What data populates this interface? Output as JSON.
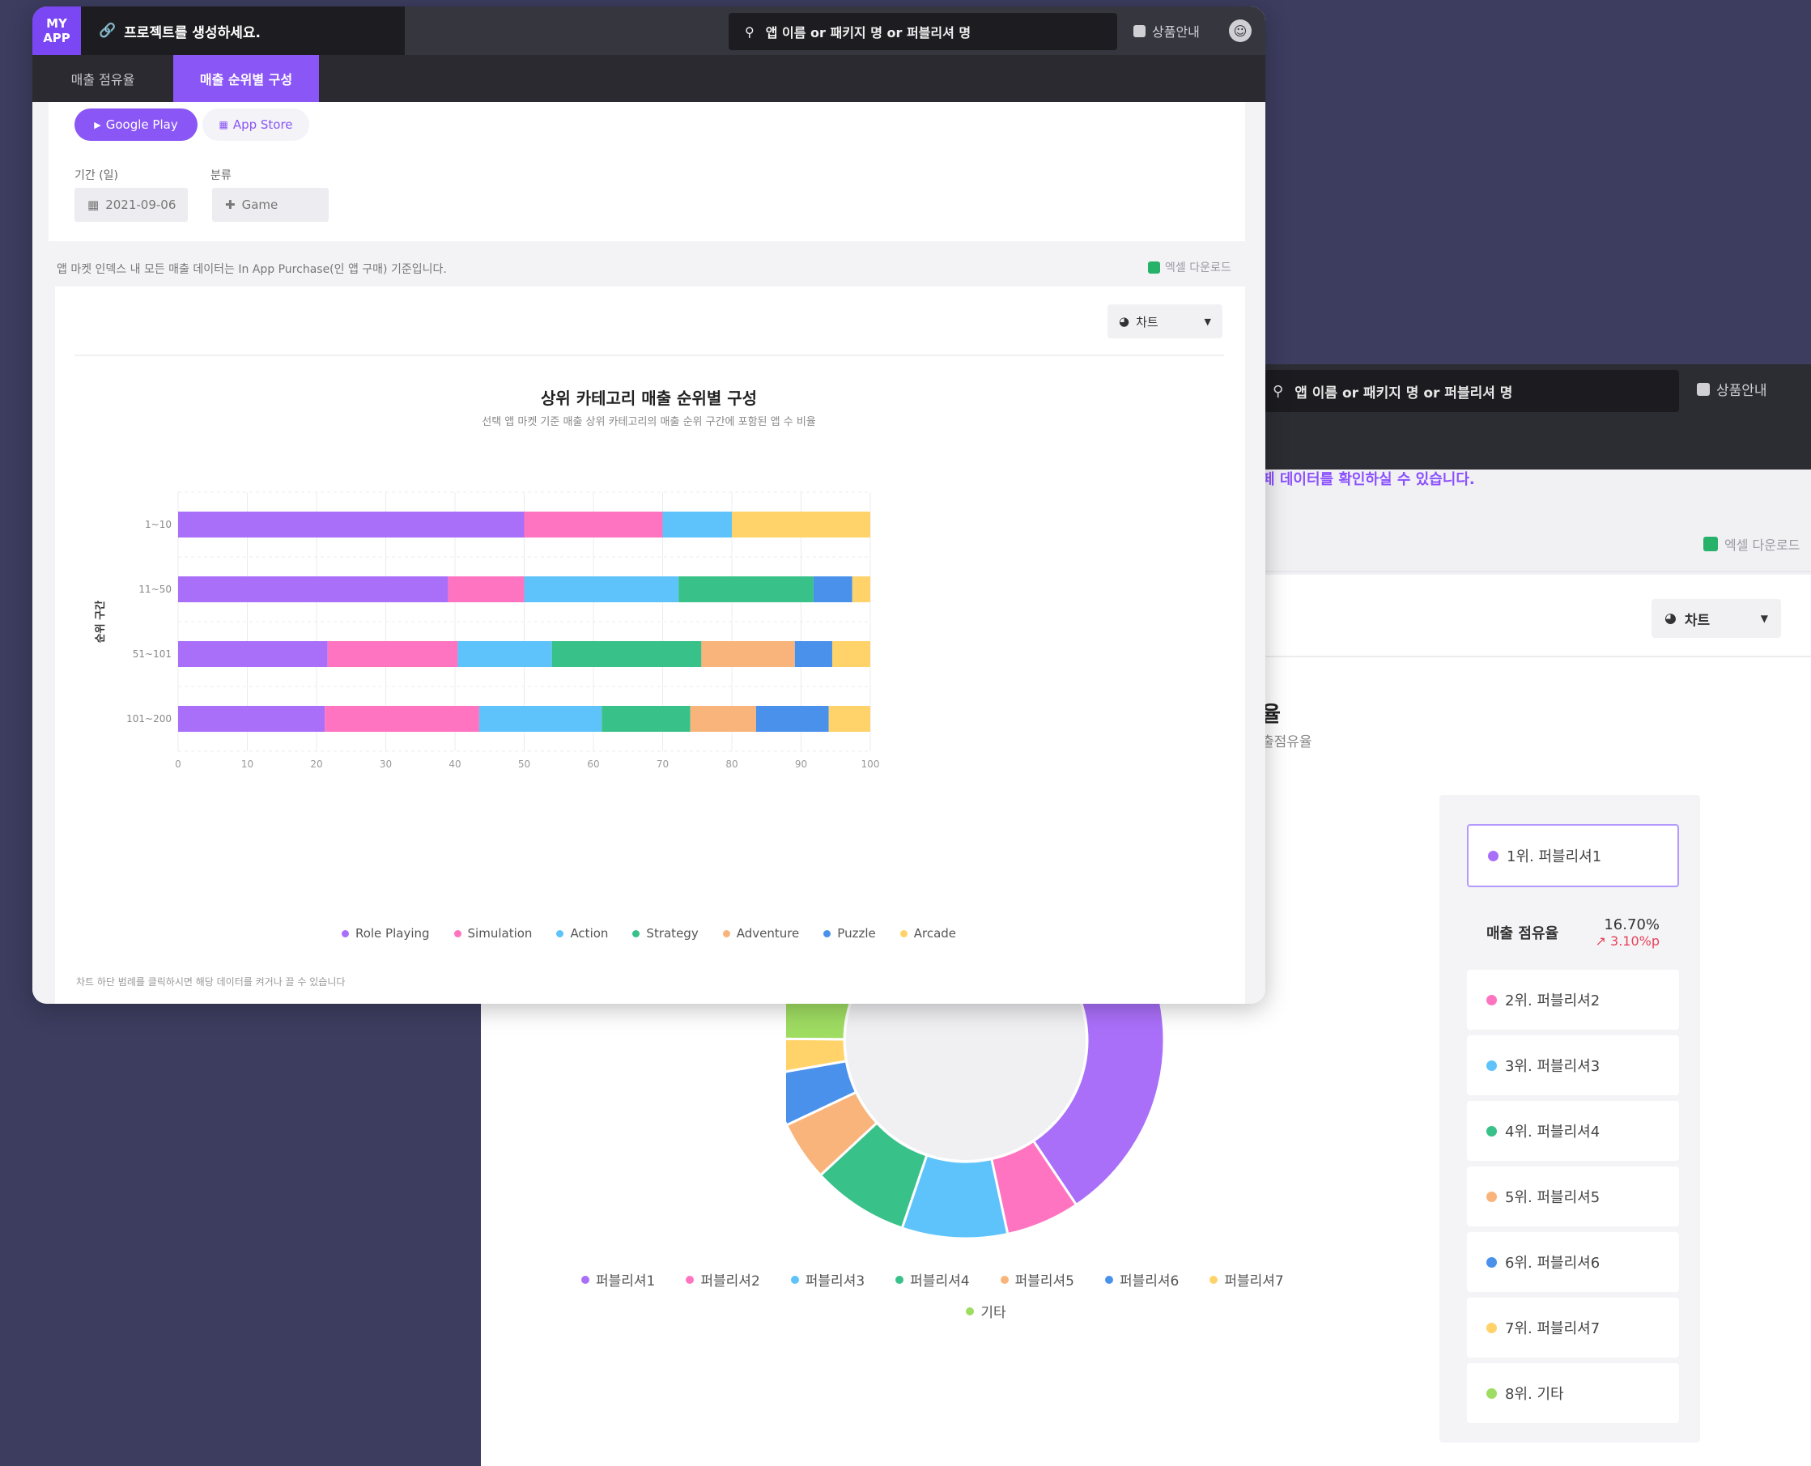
{
  "colors": {
    "accent": "#8a57f6",
    "role_playing": "#a96ff9",
    "simulation": "#ff74c0",
    "action": "#5ec3fb",
    "strategy": "#39c18a",
    "adventure": "#f9b47b",
    "puzzle": "#4a91ec",
    "arcade": "#ffd36a",
    "etc": "#9fdc62"
  },
  "front": {
    "brand": "MY\nAPP",
    "project": "프로젝트를 생성하세요.",
    "search_placeholder": "앱 이름 or 패키지 명 or 퍼블리셔 명",
    "product_info": "상품안내",
    "tabs": [
      {
        "label": "매출 점유율"
      },
      {
        "label": "매출 순위별 구성"
      }
    ],
    "store_pills": [
      {
        "label": "Google Play"
      },
      {
        "label": "App Store"
      }
    ],
    "period_label": "기간 (일)",
    "period_value": "2021-09-06",
    "category_label": "분류",
    "category_value": "Game",
    "notice": "앱 마켓 인덱스 내 모든 매출 데이터는 In App Purchase(인 앱 구매) 기준입니다.",
    "excel": "엑셀 다운로드",
    "chart_toggle": "차트",
    "footnote": "차트 하단 범례를 클릭하시면 해당 데이터를 켜거나 끌 수 있습니다"
  },
  "back": {
    "search_placeholder": "앱 이름 or 패키지 명 or 퍼블리셔 명",
    "product_info": "상품안내",
    "notice": "페 데이터를 확인하실 수 있습니다.",
    "excel": "엑셀 다운로드",
    "chart_toggle": "차트",
    "partial_title": "율",
    "partial_sub": "출점유율",
    "share_label": "매출 점유율",
    "share_value": "16.70%",
    "share_delta": "3.10%p",
    "ranks": [
      {
        "label": "1위. 퍼블리셔1",
        "color": "#a96ff9"
      },
      {
        "label": "2위. 퍼블리셔2",
        "color": "#ff74c0"
      },
      {
        "label": "3위. 퍼블리셔3",
        "color": "#5ec3fb"
      },
      {
        "label": "4위. 퍼블리셔4",
        "color": "#39c18a"
      },
      {
        "label": "5위. 퍼블리셔5",
        "color": "#f9b47b"
      },
      {
        "label": "6위. 퍼블리셔6",
        "color": "#4a91ec"
      },
      {
        "label": "7위. 퍼블리셔7",
        "color": "#ffd36a"
      },
      {
        "label": "8위. 기타",
        "color": "#9fdc62"
      }
    ],
    "legend": [
      {
        "name": "퍼블리셔1",
        "color": "#a96ff9"
      },
      {
        "name": "퍼블리셔2",
        "color": "#ff74c0"
      },
      {
        "name": "퍼블리셔3",
        "color": "#5ec3fb"
      },
      {
        "name": "퍼블리셔4",
        "color": "#39c18a"
      },
      {
        "name": "퍼블리셔5",
        "color": "#f9b47b"
      },
      {
        "name": "퍼블리셔6",
        "color": "#4a91ec"
      },
      {
        "name": "퍼블리셔7",
        "color": "#ffd36a"
      },
      {
        "name": "기타",
        "color": "#9fdc62"
      }
    ]
  },
  "chart_data": [
    {
      "type": "bar",
      "orientation": "horizontal",
      "stacked": true,
      "title": "상위 카테고리 매출 순위별 구성",
      "subtitle": "선택 앱 마켓 기준 매출 상위 카테고리의 매출 순위 구간에 포함된 앱 수 비율",
      "ylabel": "순위 구간",
      "xlabel": "",
      "categories": [
        "1~10",
        "11~50",
        "51~101",
        "101~200"
      ],
      "xlim": [
        0,
        100
      ],
      "xticks": [
        0,
        10,
        20,
        30,
        40,
        50,
        60,
        70,
        80,
        90,
        100
      ],
      "grid": true,
      "legend_position": "bottom",
      "series": [
        {
          "name": "Role Playing",
          "color": "#a96ff9",
          "values": [
            50,
            39,
            21.6,
            21.2
          ]
        },
        {
          "name": "Simulation",
          "color": "#ff74c0",
          "values": [
            20,
            11,
            18.8,
            22.3
          ]
        },
        {
          "name": "Action",
          "color": "#5ec3fb",
          "values": [
            10,
            22.3,
            13.6,
            17.7
          ]
        },
        {
          "name": "Strategy",
          "color": "#39c18a",
          "values": [
            0,
            19.5,
            21.6,
            12.8
          ]
        },
        {
          "name": "Adventure",
          "color": "#f9b47b",
          "values": [
            0,
            0,
            13.5,
            9.5
          ]
        },
        {
          "name": "Puzzle",
          "color": "#4a91ec",
          "values": [
            0,
            5.6,
            5.4,
            10.5
          ]
        },
        {
          "name": "Arcade",
          "color": "#ffd36a",
          "values": [
            20,
            2.6,
            5.5,
            6.0
          ]
        }
      ]
    },
    {
      "type": "pie",
      "donut": true,
      "partial": true,
      "categories": [
        "퍼블리셔1",
        "퍼블리셔2",
        "퍼블리셔3",
        "퍼블리셔4",
        "퍼블리셔5",
        "퍼블리셔6",
        "퍼블리셔7",
        "기타"
      ],
      "values": [
        16.7,
        4.2,
        6.0,
        5.5,
        3.4,
        3.0,
        2.0,
        29.0
      ],
      "legend_position": "bottom"
    }
  ]
}
